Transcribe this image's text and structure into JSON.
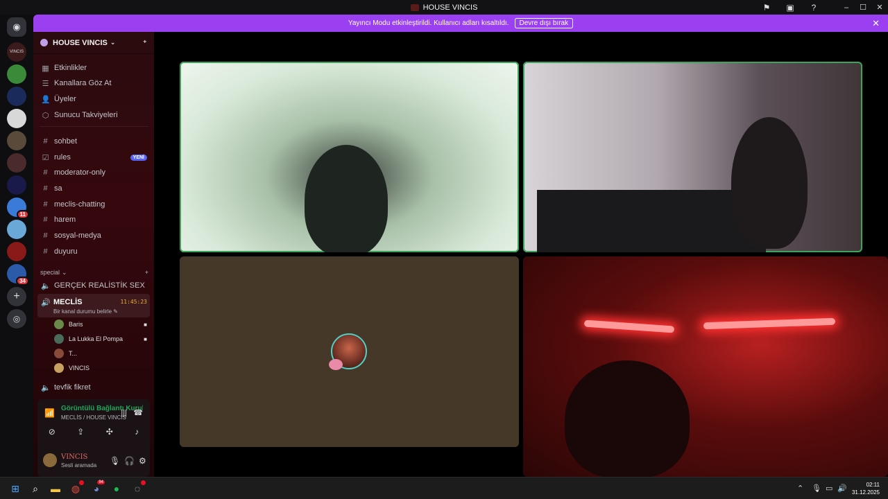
{
  "window": {
    "title": "HOUSE VINCIS"
  },
  "banner": {
    "text": "Yayıncı Modu etkinleştirildi. Kullanıcı adları kısaltıldı.",
    "button": "Devre dışı bırak"
  },
  "server": {
    "name": "HOUSE VINCIS",
    "nav": [
      {
        "label": "Etkinlikler",
        "icon": "calendar-icon"
      },
      {
        "label": "Kanallara Göz At",
        "icon": "browse-channels-icon"
      },
      {
        "label": "Üyeler",
        "icon": "members-icon"
      },
      {
        "label": "Sunucu Takviyeleri",
        "icon": "boost-icon"
      }
    ],
    "channels": [
      {
        "label": "sohbet",
        "icon": "hash-icon"
      },
      {
        "label": "rules",
        "icon": "rules-icon",
        "badge": "YENİ"
      },
      {
        "label": "moderator-only",
        "icon": "hash-icon"
      },
      {
        "label": "sa",
        "icon": "hash-icon"
      },
      {
        "label": "meclis-chatting",
        "icon": "hash-icon"
      },
      {
        "label": "harem",
        "icon": "hash-icon"
      },
      {
        "label": "sosyal-medya",
        "icon": "hash-icon"
      },
      {
        "label": "duyuru",
        "icon": "hash-icon"
      }
    ],
    "category": "special",
    "voice_channels": [
      {
        "label": "GERÇEK REALİSTİK SEX"
      },
      {
        "label": "tevfik fikret"
      }
    ],
    "active_voice": {
      "name": "MECLİS",
      "timer": "11:45:23",
      "status": "Bir kanal durumu belirle",
      "members": [
        {
          "name": "Baris",
          "camera": true,
          "color": "#6a8a4a"
        },
        {
          "name": "La Lukka El Pompa",
          "camera": true,
          "color": "#4a6a5a"
        },
        {
          "name": "T...",
          "camera": false,
          "color": "#8a4a3a"
        },
        {
          "name": "VINCIS",
          "camera": false,
          "color": "#c8a060"
        }
      ]
    }
  },
  "voice_panel": {
    "title": "Görüntülü Bağlantı Kuruldu",
    "subtitle": "MECLİS / HOUSE VINCIS"
  },
  "user": {
    "name": "VINCIS",
    "status": "Sesli aramada"
  },
  "guilds": [
    {
      "label": "Discord",
      "color": "#5865f2",
      "icon": "discord-home-icon"
    },
    {
      "label": "VINCIS",
      "color": "#3a1a1a",
      "icon": "server-vincis-icon"
    },
    {
      "label": "",
      "color": "#3a8a3a",
      "icon": "server-icon"
    },
    {
      "label": "",
      "color": "#1a2a5a",
      "icon": "server-icon"
    },
    {
      "label": "",
      "color": "#d8d8d8",
      "icon": "server-icon"
    },
    {
      "label": "",
      "color": "#5a4a3a",
      "icon": "server-icon"
    },
    {
      "label": "",
      "color": "#4a2a2a",
      "icon": "server-icon"
    },
    {
      "label": "",
      "color": "#1a1a4a",
      "icon": "server-icon"
    },
    {
      "label": "11",
      "color": "#3a7ad8",
      "icon": "server-icon"
    },
    {
      "label": "",
      "color": "#6aa8d8",
      "icon": "server-icon"
    },
    {
      "label": "",
      "color": "#8a1a1a",
      "icon": "server-icon"
    },
    {
      "label": "34",
      "color": "#2a5aa8",
      "icon": "server-icon"
    }
  ],
  "taskbar": {
    "time": "02:11",
    "date": "31.12.2025",
    "discord_badge": "94"
  }
}
